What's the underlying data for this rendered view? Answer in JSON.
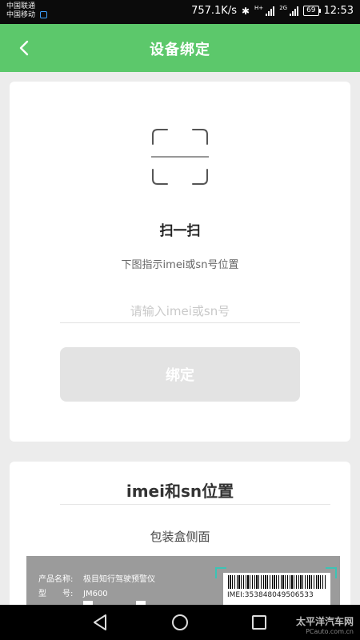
{
  "status_bar": {
    "carrier_1": "中国联通",
    "carrier_2": "中国移动",
    "net_speed": "757.1K/s",
    "net_type_1": "H+",
    "net_type_2": "2G",
    "battery": "69",
    "time": "12:53"
  },
  "header": {
    "title": "设备绑定",
    "back_icon": "chevron-left-icon",
    "bg_color": "#5cc86b"
  },
  "bind_card": {
    "scan_icon": "scan-frame-icon",
    "scan_title": "扫一扫",
    "scan_hint": "下图指示imei或sn号位置",
    "input_value": "",
    "input_placeholder": "请输入imei或sn号",
    "bind_button_label": "绑定"
  },
  "location_card": {
    "title": "imei和sn位置",
    "package_side_label": "包装盒侧面",
    "package": {
      "product_name_label": "产品名称:",
      "product_name_value": "极目知行驾驶预警仪",
      "model_label": "型　　号:",
      "model_value": "JM600",
      "imei_label": "IMEI:353848049506533"
    }
  },
  "nav_bar": {
    "back_icon": "triangle-back-icon",
    "home_icon": "circle-home-icon",
    "recents_icon": "square-recents-icon",
    "watermark_line_1": "太平洋汽车网",
    "watermark_line_2": "PCauto.com.cn"
  }
}
